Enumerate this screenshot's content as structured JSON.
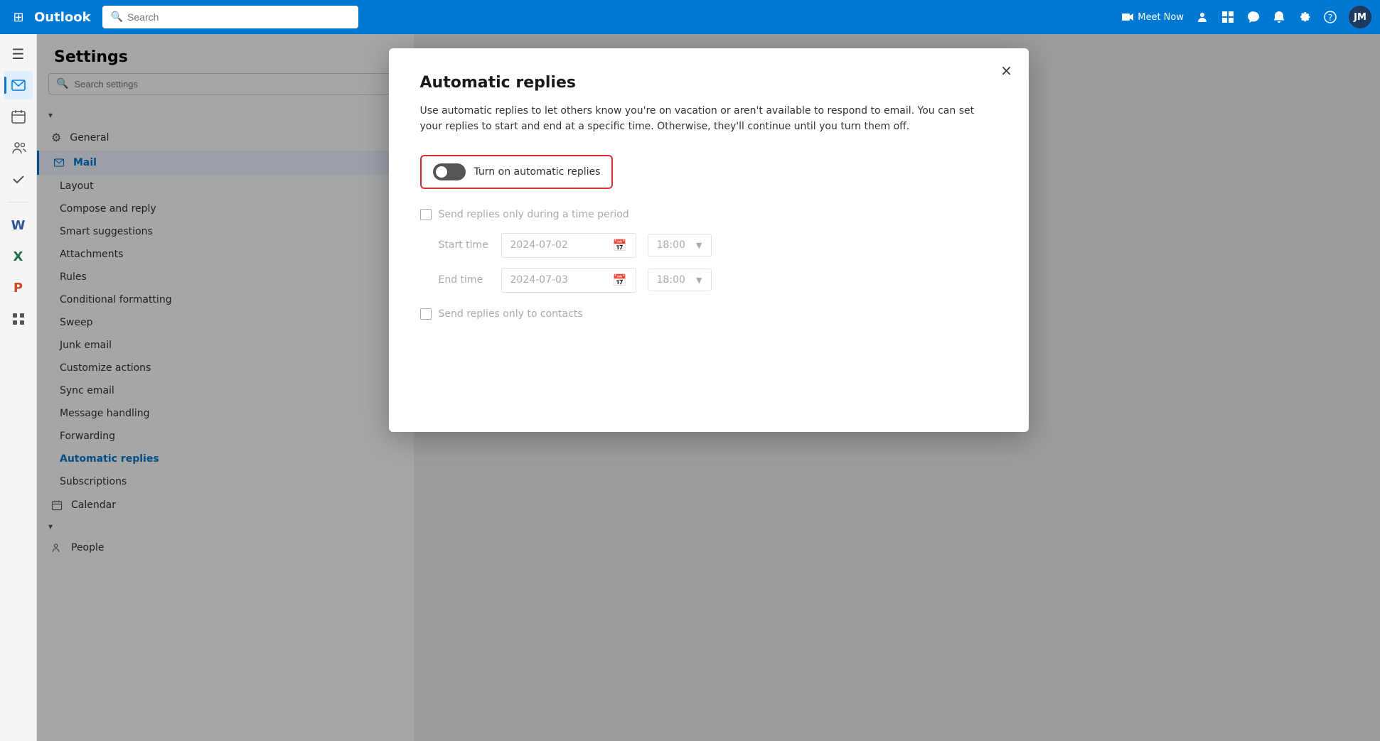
{
  "titlebar": {
    "app_name": "Outlook",
    "search_placeholder": "Search",
    "meet_now_label": "Meet Now",
    "avatar_initials": "JM"
  },
  "left_sidebar": {
    "icons": [
      {
        "name": "menu-icon",
        "symbol": "☰",
        "active": false
      },
      {
        "name": "mail-icon",
        "symbol": "✉",
        "active": false
      },
      {
        "name": "calendar-icon",
        "symbol": "📅",
        "active": false
      },
      {
        "name": "people-icon",
        "symbol": "👥",
        "active": false
      },
      {
        "name": "tasks-icon",
        "symbol": "✔",
        "active": false
      },
      {
        "name": "word-icon",
        "symbol": "W",
        "active": false
      },
      {
        "name": "excel-icon",
        "symbol": "X",
        "active": false
      },
      {
        "name": "powerpoint-icon",
        "symbol": "P",
        "active": false
      },
      {
        "name": "apps-icon",
        "symbol": "⊞",
        "active": false
      }
    ]
  },
  "settings": {
    "title": "Settings",
    "search_placeholder": "Search settings",
    "nav_sections": [
      {
        "id": "general",
        "label": "General",
        "icon": "⚙"
      },
      {
        "id": "mail",
        "label": "Mail",
        "icon": "✉",
        "active": true
      },
      {
        "id": "calendar",
        "label": "Calendar",
        "icon": "📅"
      },
      {
        "id": "people",
        "label": "People",
        "icon": "👥"
      }
    ],
    "mail_items": [
      {
        "id": "layout",
        "label": "Layout"
      },
      {
        "id": "compose",
        "label": "Compose and reply"
      },
      {
        "id": "smart",
        "label": "Smart suggestions"
      },
      {
        "id": "attachments",
        "label": "Attachments"
      },
      {
        "id": "rules",
        "label": "Rules"
      },
      {
        "id": "conditional",
        "label": "Conditional formatting"
      },
      {
        "id": "sweep",
        "label": "Sweep"
      },
      {
        "id": "junk",
        "label": "Junk email"
      },
      {
        "id": "customize",
        "label": "Customize actions"
      },
      {
        "id": "sync",
        "label": "Sync email"
      },
      {
        "id": "message",
        "label": "Message handling"
      },
      {
        "id": "forwarding",
        "label": "Forwarding"
      },
      {
        "id": "automatic",
        "label": "Automatic replies",
        "active": true
      },
      {
        "id": "subscriptions",
        "label": "Subscriptions"
      }
    ]
  },
  "dialog": {
    "title": "Automatic replies",
    "close_label": "×",
    "description": "Use automatic replies to let others know you're on vacation or aren't available to respond to email. You can set your replies to start and end at a specific time. Otherwise, they'll continue until you turn them off.",
    "toggle_label": "Turn on automatic replies",
    "toggle_on": false,
    "time_period_label": "Send replies only during a time period",
    "time_period_checked": false,
    "start_time_label": "Start time",
    "start_date": "2024-07-02",
    "start_time": "18:00",
    "end_time_label": "End time",
    "end_date": "2024-07-03",
    "end_time": "18:00",
    "contacts_label": "Send replies only to contacts",
    "contacts_checked": false
  }
}
